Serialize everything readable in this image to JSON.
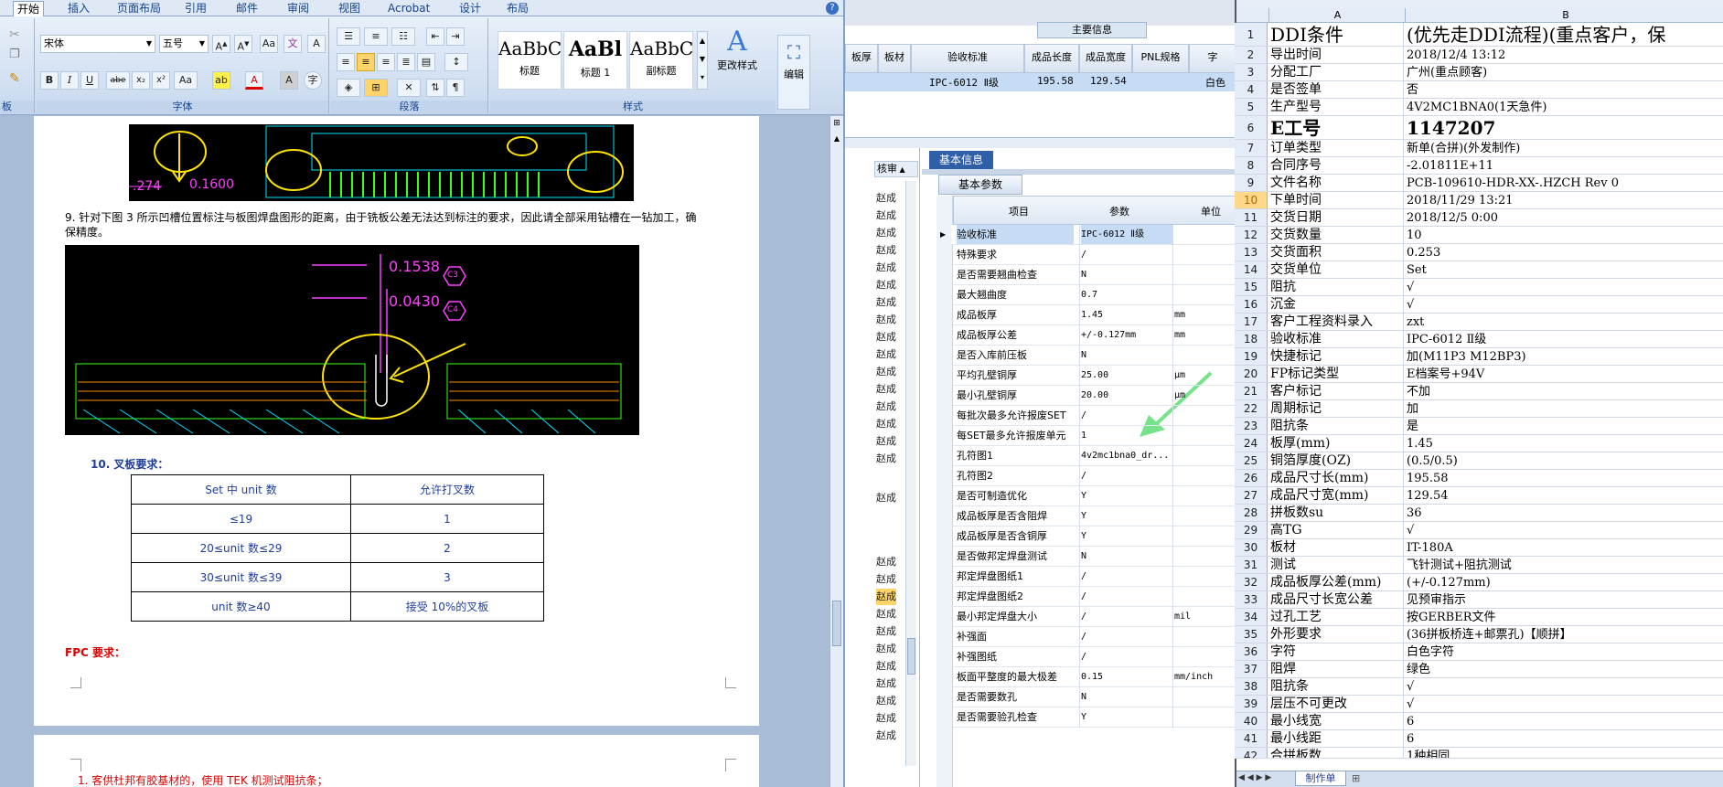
{
  "word": {
    "tabs": [
      "开始",
      "插入",
      "页面布局",
      "引用",
      "邮件",
      "审阅",
      "视图",
      "Acrobat",
      "设计",
      "布局"
    ],
    "font_name": "宋体",
    "font_size": "五号",
    "group_labels": {
      "font": "字体",
      "paragraph": "段落",
      "styles": "样式"
    },
    "styles": [
      {
        "sample": "AaBbC",
        "name": "标题"
      },
      {
        "sample": "AaBl",
        "name": "标题 1"
      },
      {
        "sample": "AaBbC",
        "name": "副标题"
      }
    ],
    "change_style": "更改样式",
    "edit": "编辑",
    "pcb1_labels": {
      "dim1": ".274",
      "dim2": "0.1600"
    },
    "item9": "9. 针对下图 3 所示凹槽位置标注与板图焊盘图形的距离，由于铣板公差无法达到标注的要求，因此请全部采用钻槽在一钻加工，确保精度。",
    "pcb2_labels": {
      "d1": "0.1538",
      "d2": "0.0430",
      "c3": "C3",
      "c4": "C4"
    },
    "item10": "10. 叉板要求：",
    "table": {
      "headers": [
        "Set 中 unit 数",
        "允许打叉数"
      ],
      "rows": [
        [
          "≤19",
          "1"
        ],
        [
          "20≤unit 数≤29",
          "2"
        ],
        [
          "30≤unit 数≤39",
          "3"
        ],
        [
          "unit 数≥40",
          "接受 10%的叉板"
        ]
      ]
    },
    "fpc": "FPC 要求：",
    "item1": "1. 客供杜邦有胶基材的，使用 TEK 机测试阻抗条；"
  },
  "mid": {
    "main_info": "主要信息",
    "top_headers": [
      "板厚",
      "板材",
      "验收标准",
      "成品长度",
      "成品宽度",
      "PNL规格",
      "字"
    ],
    "top_row": {
      "standard": "IPC-6012 Ⅱ级",
      "length": "195.58",
      "width": "129.54",
      "extra": "白色"
    },
    "basic_info": "基本信息",
    "basic_params": "基本参数",
    "review_header": "核审",
    "param_headers": [
      "项目",
      "参数",
      "单位"
    ],
    "params": [
      {
        "item": "验收标准",
        "value": "IPC-6012 Ⅱ级",
        "unit": ""
      },
      {
        "item": "特殊要求",
        "value": "/",
        "unit": ""
      },
      {
        "item": "是否需要翘曲检查",
        "value": "N",
        "unit": ""
      },
      {
        "item": "最大翘曲度",
        "value": "0.7",
        "unit": ""
      },
      {
        "item": "成品板厚",
        "value": "1.45",
        "unit": "mm"
      },
      {
        "item": "成品板厚公差",
        "value": "+/-0.127mm",
        "unit": "mm"
      },
      {
        "item": "是否入库前压板",
        "value": "N",
        "unit": ""
      },
      {
        "item": "平均孔壁铜厚",
        "value": "25.00",
        "unit": "μm"
      },
      {
        "item": "最小孔壁铜厚",
        "value": "20.00",
        "unit": "μm"
      },
      {
        "item": "每批次最多允许报废SET",
        "value": "/",
        "unit": ""
      },
      {
        "item": "每SET最多允许报废单元",
        "value": "1",
        "unit": ""
      },
      {
        "item": "孔符图1",
        "value": "4v2mc1bna0_dr...",
        "unit": ""
      },
      {
        "item": "孔符图2",
        "value": "/",
        "unit": ""
      },
      {
        "item": "是否可制造优化",
        "value": "Y",
        "unit": ""
      },
      {
        "item": "成品板厚是否含阻焊",
        "value": "Y",
        "unit": ""
      },
      {
        "item": "成品板厚是否含铜厚",
        "value": "Y",
        "unit": ""
      },
      {
        "item": "是否做邦定焊盘测试",
        "value": "N",
        "unit": ""
      },
      {
        "item": "邦定焊盘图纸1",
        "value": "/",
        "unit": ""
      },
      {
        "item": "邦定焊盘图纸2",
        "value": "/",
        "unit": ""
      },
      {
        "item": "最小邦定焊盘大小",
        "value": "/",
        "unit": "mil"
      },
      {
        "item": "补强面",
        "value": "/",
        "unit": ""
      },
      {
        "item": "补强图纸",
        "value": "/",
        "unit": ""
      },
      {
        "item": "板面平整度的最大极差",
        "value": "0.15",
        "unit": "mm/inch"
      },
      {
        "item": "是否需要数孔",
        "value": "N",
        "unit": ""
      },
      {
        "item": "是否需要验孔检查",
        "value": "Y",
        "unit": ""
      }
    ],
    "reviewer": "赵成"
  },
  "excel": {
    "col_a": "A",
    "col_b": "B",
    "rows": [
      {
        "n": "1",
        "a": "DDI条件",
        "b": "(优先走DDI流程)(重点客户，保"
      },
      {
        "n": "2",
        "a": "导出时间",
        "b": "2018/12/4 13:12"
      },
      {
        "n": "3",
        "a": "分配工厂",
        "b": "广州(重点顾客)"
      },
      {
        "n": "4",
        "a": "是否签单",
        "b": "否"
      },
      {
        "n": "5",
        "a": "生产型号",
        "b": "4V2MC1BNA0(1天急件)"
      },
      {
        "n": "6",
        "a": "E工号",
        "b": "1147207"
      },
      {
        "n": "7",
        "a": "订单类型",
        "b": "新单(合拼)(外发制作)"
      },
      {
        "n": "8",
        "a": "合同序号",
        "b": "-2.01811E+11"
      },
      {
        "n": "9",
        "a": "文件名称",
        "b": "PCB-109610-HDR-XX-.HZCH Rev 0"
      },
      {
        "n": "10",
        "a": "下单时间",
        "b": "2018/11/29 13:21"
      },
      {
        "n": "11",
        "a": "交货日期",
        "b": "2018/12/5 0:00"
      },
      {
        "n": "12",
        "a": "交货数量",
        "b": "10"
      },
      {
        "n": "13",
        "a": "交货面积",
        "b": "0.253"
      },
      {
        "n": "14",
        "a": "交货单位",
        "b": "Set"
      },
      {
        "n": "15",
        "a": "阻抗",
        "b": "√"
      },
      {
        "n": "16",
        "a": "沉金",
        "b": "√"
      },
      {
        "n": "17",
        "a": "客户工程资料录入",
        "b": "zxt"
      },
      {
        "n": "18",
        "a": "验收标准",
        "b": "IPC-6012 Ⅱ级"
      },
      {
        "n": "19",
        "a": "快捷标记",
        "b": "加(M11P3 M12BP3)"
      },
      {
        "n": "20",
        "a": "FP标记类型",
        "b": "E档案号+94V"
      },
      {
        "n": "21",
        "a": "客户标记",
        "b": "不加"
      },
      {
        "n": "22",
        "a": "周期标记",
        "b": "加"
      },
      {
        "n": "23",
        "a": "阻抗条",
        "b": "是"
      },
      {
        "n": "24",
        "a": "板厚(mm)",
        "b": "1.45"
      },
      {
        "n": "25",
        "a": "铜箔厚度(OZ)",
        "b": "(0.5/0.5)"
      },
      {
        "n": "26",
        "a": "成品尺寸长(mm)",
        "b": "195.58"
      },
      {
        "n": "27",
        "a": "成品尺寸宽(mm)",
        "b": "129.54"
      },
      {
        "n": "28",
        "a": "拼板数su",
        "b": "36"
      },
      {
        "n": "29",
        "a": "高TG",
        "b": "√"
      },
      {
        "n": "30",
        "a": "板材",
        "b": "IT-180A"
      },
      {
        "n": "31",
        "a": "测试",
        "b": "飞针测试+阻抗测试"
      },
      {
        "n": "32",
        "a": "成品板厚公差(mm)",
        "b": "(+/-0.127mm)"
      },
      {
        "n": "33",
        "a": "成品尺寸长宽公差",
        "b": "见预审指示"
      },
      {
        "n": "34",
        "a": "过孔工艺",
        "b": "按GERBER文件"
      },
      {
        "n": "35",
        "a": "外形要求",
        "b": "(36拼板桥连+邮票孔)【顺拼】"
      },
      {
        "n": "36",
        "a": "字符",
        "b": "白色字符"
      },
      {
        "n": "37",
        "a": "阻焊",
        "b": "绿色"
      },
      {
        "n": "38",
        "a": "阻抗条",
        "b": "√"
      },
      {
        "n": "39",
        "a": "层压不可更改",
        "b": "√"
      },
      {
        "n": "40",
        "a": "最小线宽",
        "b": "6"
      },
      {
        "n": "41",
        "a": "最小线距",
        "b": "6"
      },
      {
        "n": "42",
        "a": "合拼板数",
        "b": "1种相同"
      }
    ],
    "sheet_tab": "制作单"
  }
}
